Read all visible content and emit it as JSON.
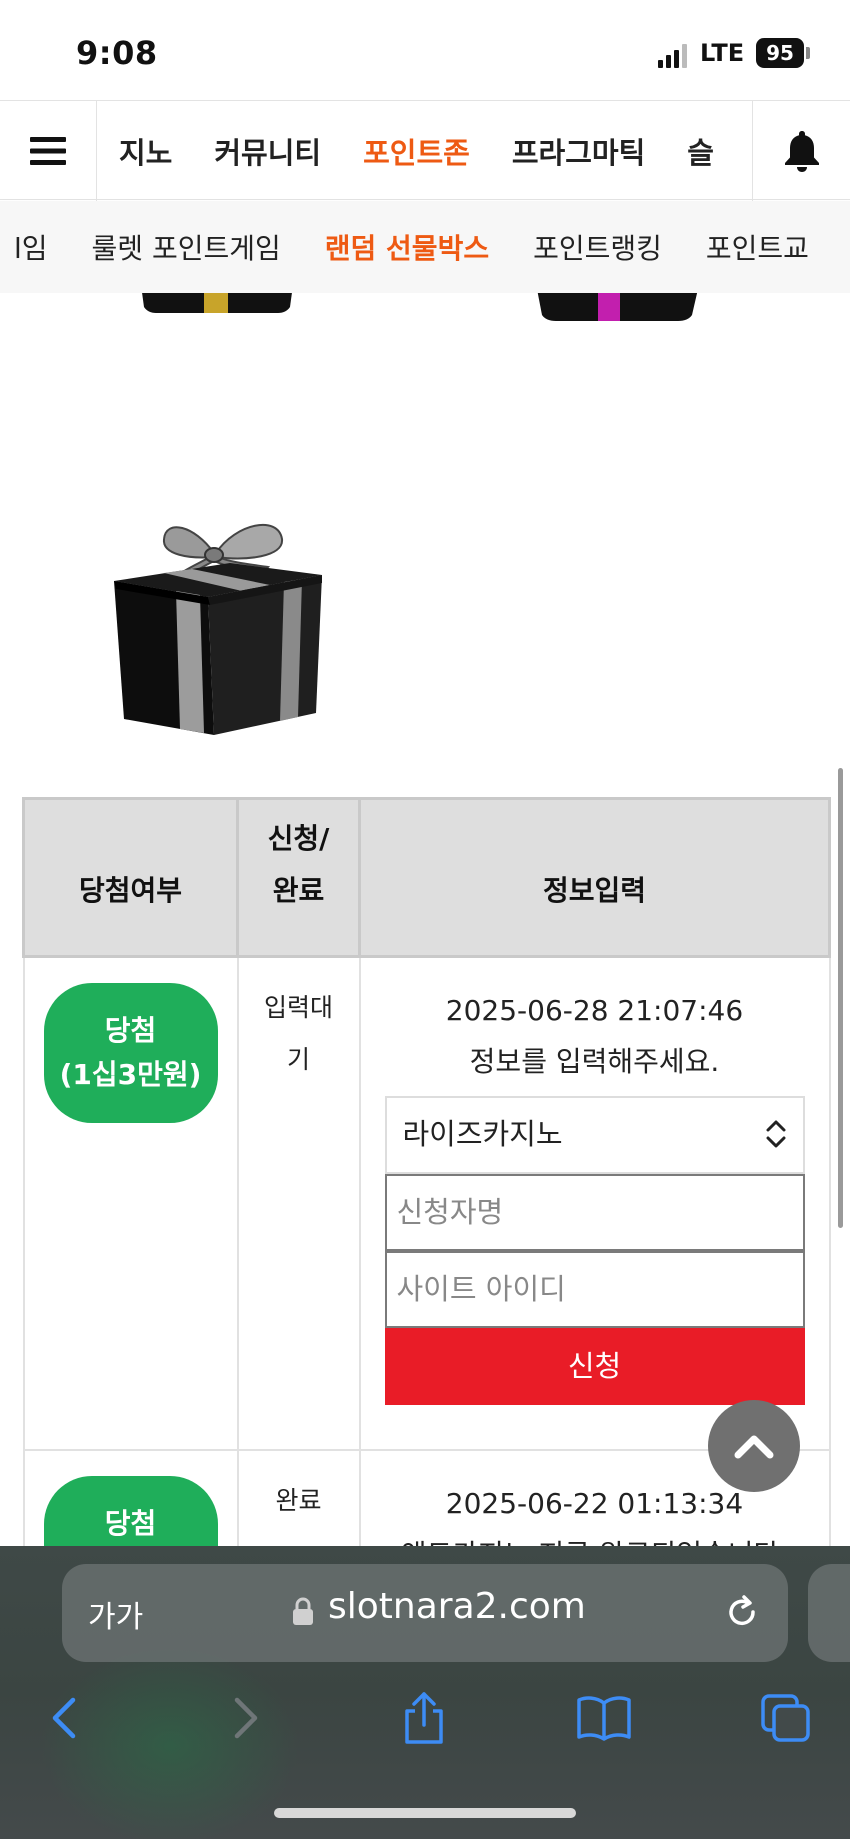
{
  "status_bar": {
    "time": "9:08",
    "network": "LTE",
    "battery": "95"
  },
  "main_nav": {
    "items": [
      {
        "label": "지노",
        "active": false
      },
      {
        "label": "커뮤니티",
        "active": false
      },
      {
        "label": "포인트존",
        "active": true
      },
      {
        "label": "프라그마틱",
        "active": false
      },
      {
        "label": "슬",
        "active": false
      }
    ],
    "menu_icon": "hamburger-menu-icon",
    "bell_icon": "bell-icon"
  },
  "sub_nav": {
    "items": [
      {
        "label": "l임",
        "active": false
      },
      {
        "label": "룰렛 포인트게임",
        "active": false
      },
      {
        "label": "랜덤 선물박스",
        "active": true
      },
      {
        "label": "포인트랭킹",
        "active": false
      },
      {
        "label": "포인트교",
        "active": false
      }
    ]
  },
  "gift_boxes": [
    {
      "ribbon_color": "#c8a42a",
      "visible": "partial"
    },
    {
      "ribbon_color": "#c21fae",
      "visible": "partial"
    },
    {
      "ribbon_color": "#9a9a9a",
      "visible": "full"
    }
  ],
  "results_table": {
    "headers": {
      "win": "당첨여부",
      "status_line1": "신청/",
      "status_line2": "완료",
      "info": "정보입력"
    },
    "rows": [
      {
        "badge_line1": "당첨",
        "badge_line2": "(1십3만원)",
        "status_line1": "입력대",
        "status_line2": "기",
        "datetime": "2025-06-28 21:07:46",
        "message": "정보를 입력해주세요.",
        "site_select": "라이즈카지노",
        "name_placeholder": "신청자명",
        "id_placeholder": "사이트 아이디",
        "apply_label": "신청"
      },
      {
        "badge_line1": "당첨",
        "status_line1": "완료",
        "datetime": "2025-06-22 01:13:34",
        "message": "앤드카지노 지급 완료되었습니다."
      }
    ]
  },
  "browser": {
    "text_size_label": "가가",
    "url": "slotnara2.com"
  },
  "colors": {
    "accent": "#ee5a13",
    "win_badge": "#1fae5a",
    "apply_button": "#e91c27"
  }
}
